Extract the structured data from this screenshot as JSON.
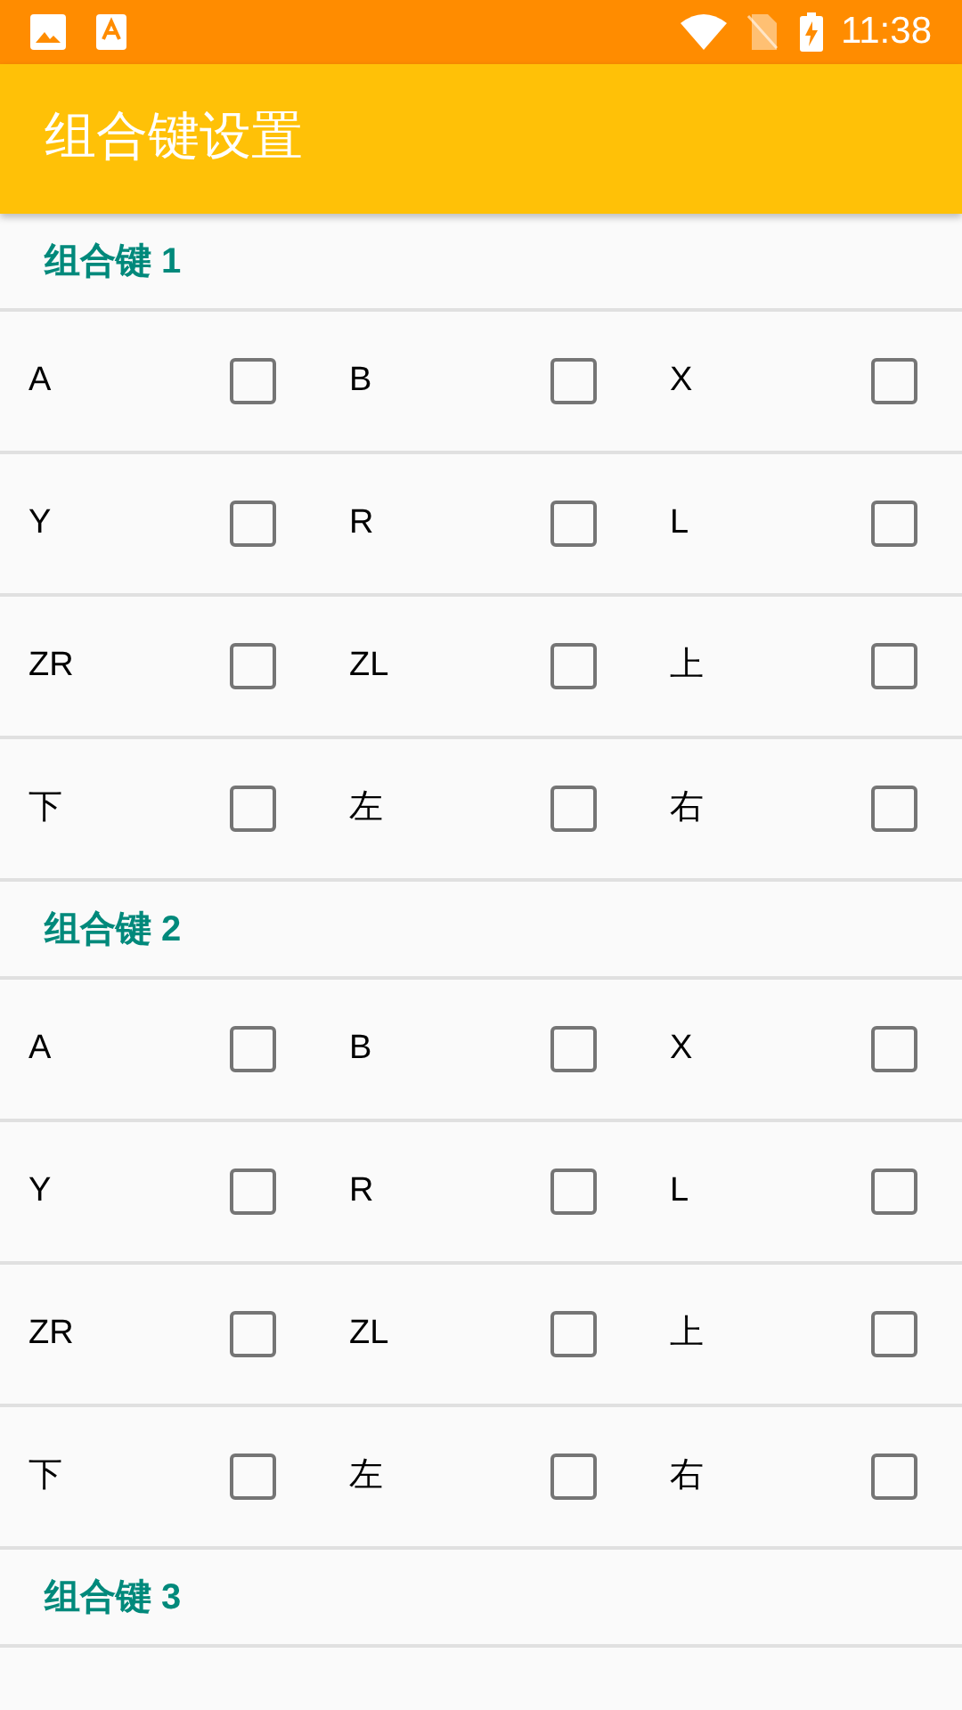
{
  "status_bar": {
    "time": "11:38"
  },
  "app_bar": {
    "title": "组合键设置"
  },
  "sections": [
    {
      "title": "组合键 1",
      "rows": [
        [
          {
            "label": "A",
            "checked": false
          },
          {
            "label": "B",
            "checked": false
          },
          {
            "label": "X",
            "checked": false
          }
        ],
        [
          {
            "label": "Y",
            "checked": false
          },
          {
            "label": "R",
            "checked": false
          },
          {
            "label": "L",
            "checked": false
          }
        ],
        [
          {
            "label": "ZR",
            "checked": false
          },
          {
            "label": "ZL",
            "checked": false
          },
          {
            "label": "上",
            "checked": false
          }
        ],
        [
          {
            "label": "下",
            "checked": false
          },
          {
            "label": "左",
            "checked": false
          },
          {
            "label": "右",
            "checked": false
          }
        ]
      ]
    },
    {
      "title": "组合键 2",
      "rows": [
        [
          {
            "label": "A",
            "checked": false
          },
          {
            "label": "B",
            "checked": false
          },
          {
            "label": "X",
            "checked": false
          }
        ],
        [
          {
            "label": "Y",
            "checked": false
          },
          {
            "label": "R",
            "checked": false
          },
          {
            "label": "L",
            "checked": false
          }
        ],
        [
          {
            "label": "ZR",
            "checked": false
          },
          {
            "label": "ZL",
            "checked": false
          },
          {
            "label": "上",
            "checked": false
          }
        ],
        [
          {
            "label": "下",
            "checked": false
          },
          {
            "label": "左",
            "checked": false
          },
          {
            "label": "右",
            "checked": false
          }
        ]
      ]
    },
    {
      "title": "组合键 3"
    }
  ]
}
